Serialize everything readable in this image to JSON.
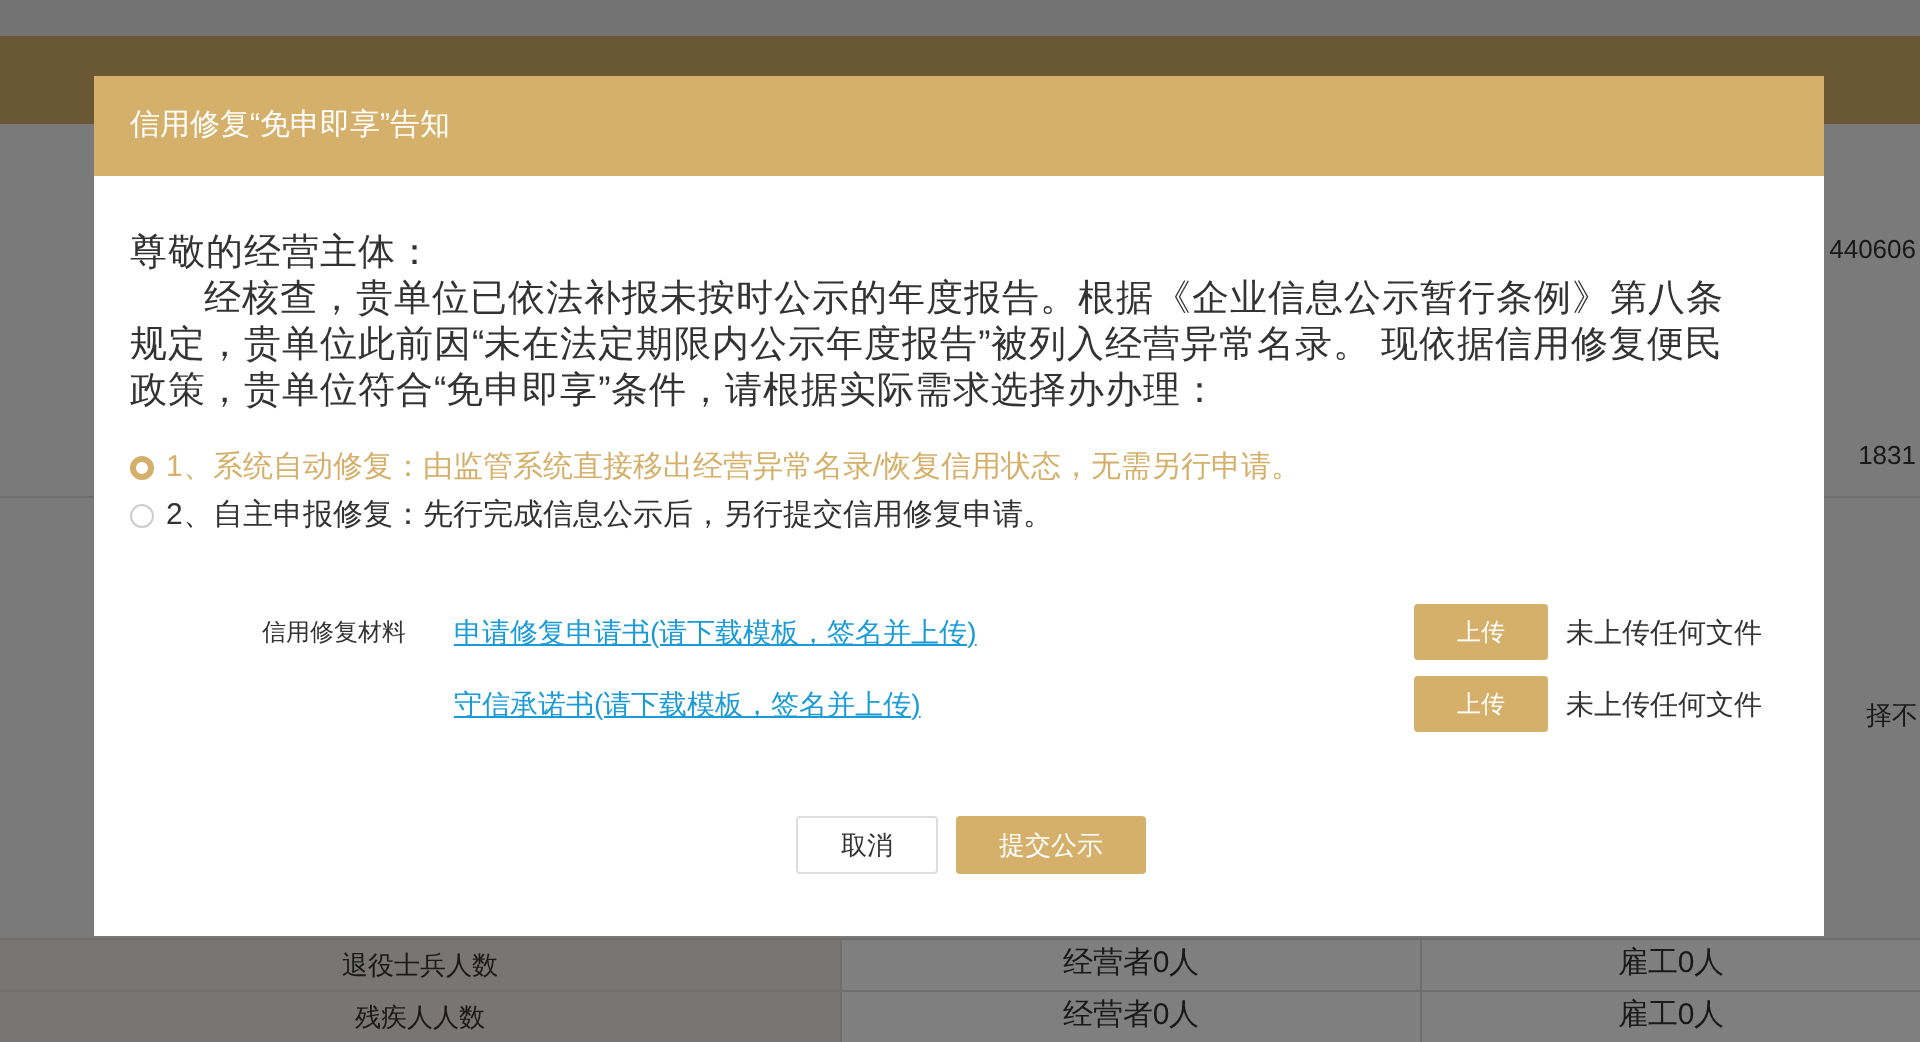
{
  "background": {
    "side_values": [
      "440606",
      "1831",
      "择不"
    ],
    "rows": [
      {
        "label": "退役士兵人数",
        "owners": "经营者0人",
        "employees": "雇工0人"
      },
      {
        "label": "残疾人人数",
        "owners": "经营者0人",
        "employees": "雇工0人"
      }
    ]
  },
  "dialog": {
    "title": "信用修复“免申即享”告知",
    "greeting": "尊敬的经营主体：",
    "body": "经核查，贵单位已依法补报未按时公示的年度报告。根据《企业信息公示暂行条例》第八条规定，贵单位此前因“未在法定期限内公示年度报告”被列入经营异常名录。 现依据信用修复便民政策，贵单位符合“免申即享”条件，请根据实际需求选择办办理：",
    "options": [
      {
        "label": "1、系统自动修复：由监管系统直接移出经营异常名录/恢复信用状态，无需另行申请。",
        "selected": true
      },
      {
        "label": "2、自主申报修复：先行完成信息公示后，另行提交信用修复申请。",
        "selected": false
      }
    ],
    "materials": {
      "label": "信用修复材料",
      "items": [
        {
          "link": "申请修复申请书(请下载模板，签名并上传)",
          "button": "上传",
          "status": "未上传任何文件"
        },
        {
          "link": "守信承诺书(请下载模板，签名并上传)",
          "button": "上传",
          "status": "未上传任何文件"
        }
      ]
    },
    "buttons": {
      "cancel": "取消",
      "submit": "提交公示"
    }
  }
}
